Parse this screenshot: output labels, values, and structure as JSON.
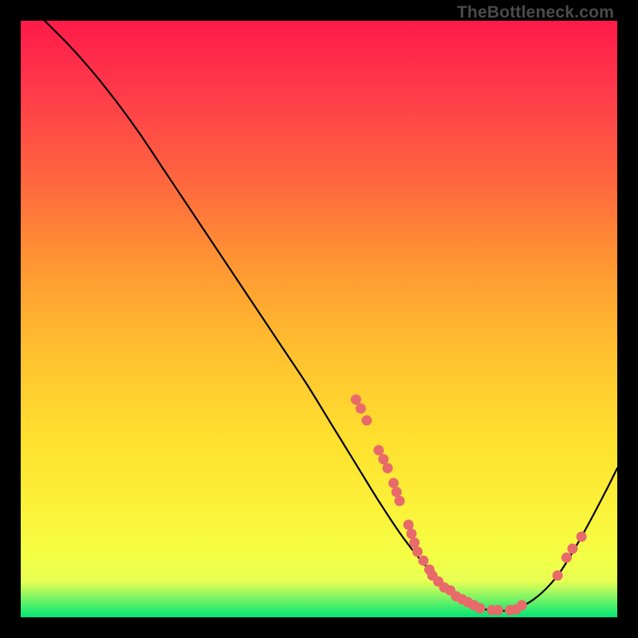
{
  "watermark": "TheBottleneck.com",
  "colors": {
    "page_bg": "#000000",
    "curve": "#000000",
    "point": "#e86a6a",
    "gradient_stops": [
      "#ff1a49",
      "#ff3b4a",
      "#ff6a3e",
      "#ff9433",
      "#ffbf2f",
      "#ffe02f",
      "#fbf23a",
      "#f3ff45",
      "#e7ff55",
      "#00e676"
    ]
  },
  "chart_data": {
    "type": "line",
    "title": "",
    "xlabel": "",
    "ylabel": "",
    "xlim": [
      0,
      100
    ],
    "ylim": [
      0,
      100
    ],
    "grid": false,
    "legend": false,
    "series": [
      {
        "name": "curve",
        "x": [
          4,
          8,
          12,
          16,
          20,
          24,
          28,
          32,
          36,
          40,
          44,
          48,
          52,
          56,
          60,
          64,
          68,
          72,
          74,
          76,
          78,
          82,
          86,
          90,
          94,
          98,
          100
        ],
        "y": [
          100,
          96,
          91.5,
          86.5,
          81,
          75,
          69,
          63,
          57,
          51,
          45,
          39,
          32.5,
          26,
          19.5,
          13.5,
          8.5,
          4.5,
          3,
          2,
          1.3,
          1.2,
          3,
          7,
          13.5,
          21,
          25
        ]
      }
    ],
    "points": [
      {
        "x": 56.2,
        "y": 36.5
      },
      {
        "x": 57.0,
        "y": 35.0
      },
      {
        "x": 58.0,
        "y": 33.0
      },
      {
        "x": 60.0,
        "y": 28.0
      },
      {
        "x": 60.8,
        "y": 26.5
      },
      {
        "x": 61.5,
        "y": 25.0
      },
      {
        "x": 62.5,
        "y": 22.5
      },
      {
        "x": 63.0,
        "y": 21.0
      },
      {
        "x": 63.5,
        "y": 19.5
      },
      {
        "x": 65.0,
        "y": 15.5
      },
      {
        "x": 65.5,
        "y": 14.0
      },
      {
        "x": 66.0,
        "y": 12.5
      },
      {
        "x": 66.5,
        "y": 11.0
      },
      {
        "x": 67.5,
        "y": 9.5
      },
      {
        "x": 68.5,
        "y": 8.0
      },
      {
        "x": 69.0,
        "y": 7.0
      },
      {
        "x": 70.0,
        "y": 6.0
      },
      {
        "x": 71.0,
        "y": 5.0
      },
      {
        "x": 72.0,
        "y": 4.5
      },
      {
        "x": 73.0,
        "y": 3.5
      },
      {
        "x": 74.0,
        "y": 3.0
      },
      {
        "x": 75.0,
        "y": 2.5
      },
      {
        "x": 76.0,
        "y": 2.0
      },
      {
        "x": 77.0,
        "y": 1.5
      },
      {
        "x": 79.0,
        "y": 1.2
      },
      {
        "x": 80.0,
        "y": 1.2
      },
      {
        "x": 82.0,
        "y": 1.2
      },
      {
        "x": 83.0,
        "y": 1.3
      },
      {
        "x": 84.0,
        "y": 2.0
      },
      {
        "x": 90.0,
        "y": 7.0
      },
      {
        "x": 91.5,
        "y": 10.0
      },
      {
        "x": 92.5,
        "y": 11.5
      },
      {
        "x": 94.0,
        "y": 13.5
      }
    ]
  }
}
